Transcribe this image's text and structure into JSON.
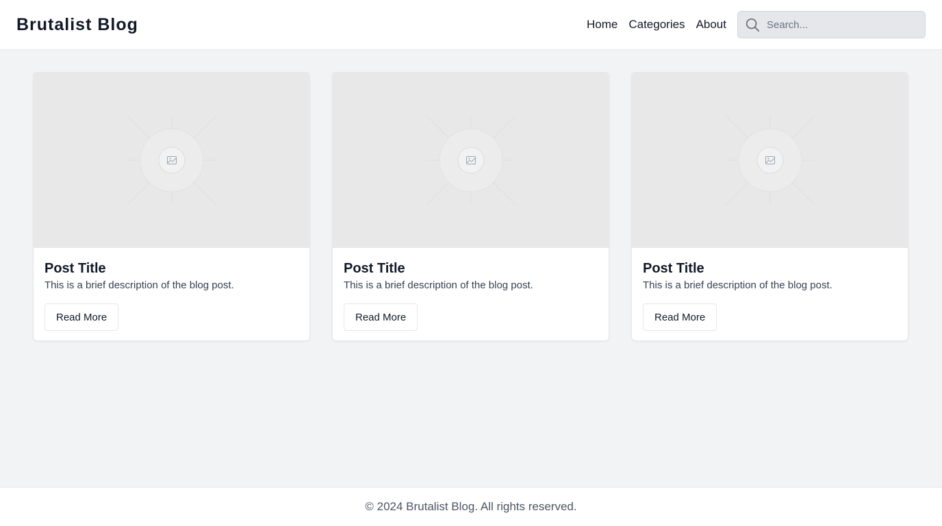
{
  "header": {
    "title": "Brutalist Blog",
    "nav": [
      {
        "label": "Home"
      },
      {
        "label": "Categories"
      },
      {
        "label": "About"
      }
    ],
    "search": {
      "placeholder": "Search...",
      "value": "",
      "icon": "search-icon"
    }
  },
  "posts": [
    {
      "title": "Post Title",
      "description": "This is a brief description of the blog post.",
      "button_label": "Read More",
      "image_icon": "image-placeholder-icon"
    },
    {
      "title": "Post Title",
      "description": "This is a brief description of the blog post.",
      "button_label": "Read More",
      "image_icon": "image-placeholder-icon"
    },
    {
      "title": "Post Title",
      "description": "This is a brief description of the blog post.",
      "button_label": "Read More",
      "image_icon": "image-placeholder-icon"
    }
  ],
  "footer": {
    "text": "© 2024 Brutalist Blog. All rights reserved."
  },
  "colors": {
    "background": "#f2f3f5",
    "surface": "#ffffff",
    "border": "#e5e7eb",
    "text": "#111827",
    "muted": "#4b5563"
  }
}
